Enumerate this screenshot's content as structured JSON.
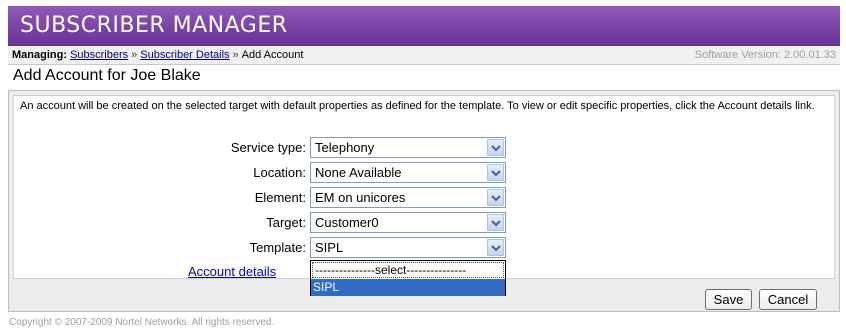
{
  "app": {
    "title": "SUBSCRIBER MANAGER"
  },
  "breadcrumb": {
    "prefix": "Managing:",
    "items": [
      "Subscribers",
      "Subscriber Details",
      "Add Account"
    ],
    "separator": "»"
  },
  "version": "Software Version: 2.00.01.33",
  "page": {
    "title": "Add Account for Joe Blake"
  },
  "description": "An account will be created on the selected target with default properties as defined for the template. To view or edit specific properties, click the Account details link.",
  "form": {
    "fields": [
      {
        "label": "Service type:",
        "value": "Telephony"
      },
      {
        "label": "Location:",
        "value": "None Available"
      },
      {
        "label": "Element:",
        "value": "EM on unicores"
      },
      {
        "label": "Target:",
        "value": "Customer0"
      },
      {
        "label": "Template:",
        "value": "SIPL"
      }
    ],
    "template_dropdown": {
      "options": [
        "---------------select---------------",
        "SIPL"
      ],
      "highlighted": "SIPL"
    },
    "account_details_link": "Account details"
  },
  "buttons": {
    "save": "Save",
    "cancel": "Cancel"
  },
  "footer": "Copyright © 2007-2009 Nortel Networks. All rights reserved.",
  "colors": {
    "banner": "#7a43a6",
    "accent": "#316ac5",
    "link": "#0000cc"
  }
}
